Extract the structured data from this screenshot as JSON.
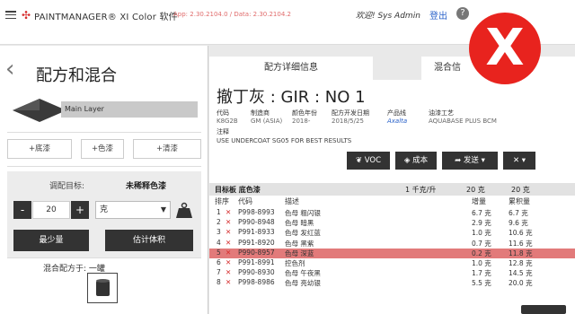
{
  "app": {
    "brand": "PAINTMANAGER® XI Color 软件",
    "version": "App: 2.30.2104.0 / Data: 2.30.2104.2",
    "welcome": "欢迎! Sys Admin",
    "logout": "登出",
    "help": "?",
    "status_mark": "X"
  },
  "left": {
    "title": "配方和混合",
    "layer": "Main Layer",
    "add_buttons": [
      "+底漆",
      "+色漆",
      "+清漆"
    ],
    "target_label": "调配目标:",
    "target_value": "未稀释色漆",
    "minus": "-",
    "plus": "+",
    "quantity": "20",
    "unit": "克",
    "min_button": "最少量",
    "estimate_button": "估计体积",
    "mix_label": "混合配方于: 一罐"
  },
  "right": {
    "tab_detail": "配方详细信息",
    "tab_mix": "混合信",
    "formula_title": "撤丁灰 : GIR : NO 1",
    "meta": {
      "headers": [
        "代码",
        "制造商",
        "颜色年份",
        "配方开发日期",
        "产品线",
        "油漆工艺"
      ],
      "values": [
        "K8G2B",
        "GM (ASIA)",
        "2018-",
        "2018/5/25",
        "Axalta",
        "AQUABASE PLUS BCM"
      ]
    },
    "note_label": "注释",
    "note": "USE UNDERCOAT SG05 FOR BEST RESULTS",
    "actions": [
      "VOC",
      "成本",
      "发送"
    ],
    "grid": {
      "title": "目标板 底色漆",
      "volume": "1 千克/升",
      "amount": "20 克",
      "cumulative": "20 克",
      "columns": [
        "排序",
        "代码",
        "描述",
        "增量",
        "累积量"
      ],
      "rows": [
        {
          "n": "1",
          "code": "P998-8993",
          "desc": "色母 粗闪银",
          "inc": "6.7 克",
          "cum": "6.7 克"
        },
        {
          "n": "2",
          "code": "P990-8948",
          "desc": "色母 暗黑",
          "inc": "2.9 克",
          "cum": "9.6 克"
        },
        {
          "n": "3",
          "code": "P991-8933",
          "desc": "色母 发红蓝",
          "inc": "1.0 克",
          "cum": "10.6 克"
        },
        {
          "n": "4",
          "code": "P991-8920",
          "desc": "色母 黑紫",
          "inc": "0.7 克",
          "cum": "11.6 克"
        },
        {
          "n": "5",
          "code": "P990-8957",
          "desc": "色母 深蓝",
          "inc": "0.2 克",
          "cum": "11.8 克"
        },
        {
          "n": "6",
          "code": "P991-8991",
          "desc": "控色剂",
          "inc": "1.0 克",
          "cum": "12.8 克"
        },
        {
          "n": "7",
          "code": "P990-8930",
          "desc": "色母 午夜黑",
          "inc": "1.7 克",
          "cum": "14.5 克"
        },
        {
          "n": "8",
          "code": "P998-8986",
          "desc": "色母 亮幼银",
          "inc": "5.5 克",
          "cum": "20.0 克"
        }
      ]
    }
  },
  "colors": {
    "accent_red": "#e8231e",
    "dark_button": "#333333",
    "highlight_row": "#e27a7a",
    "link_blue": "#2a62c9"
  }
}
